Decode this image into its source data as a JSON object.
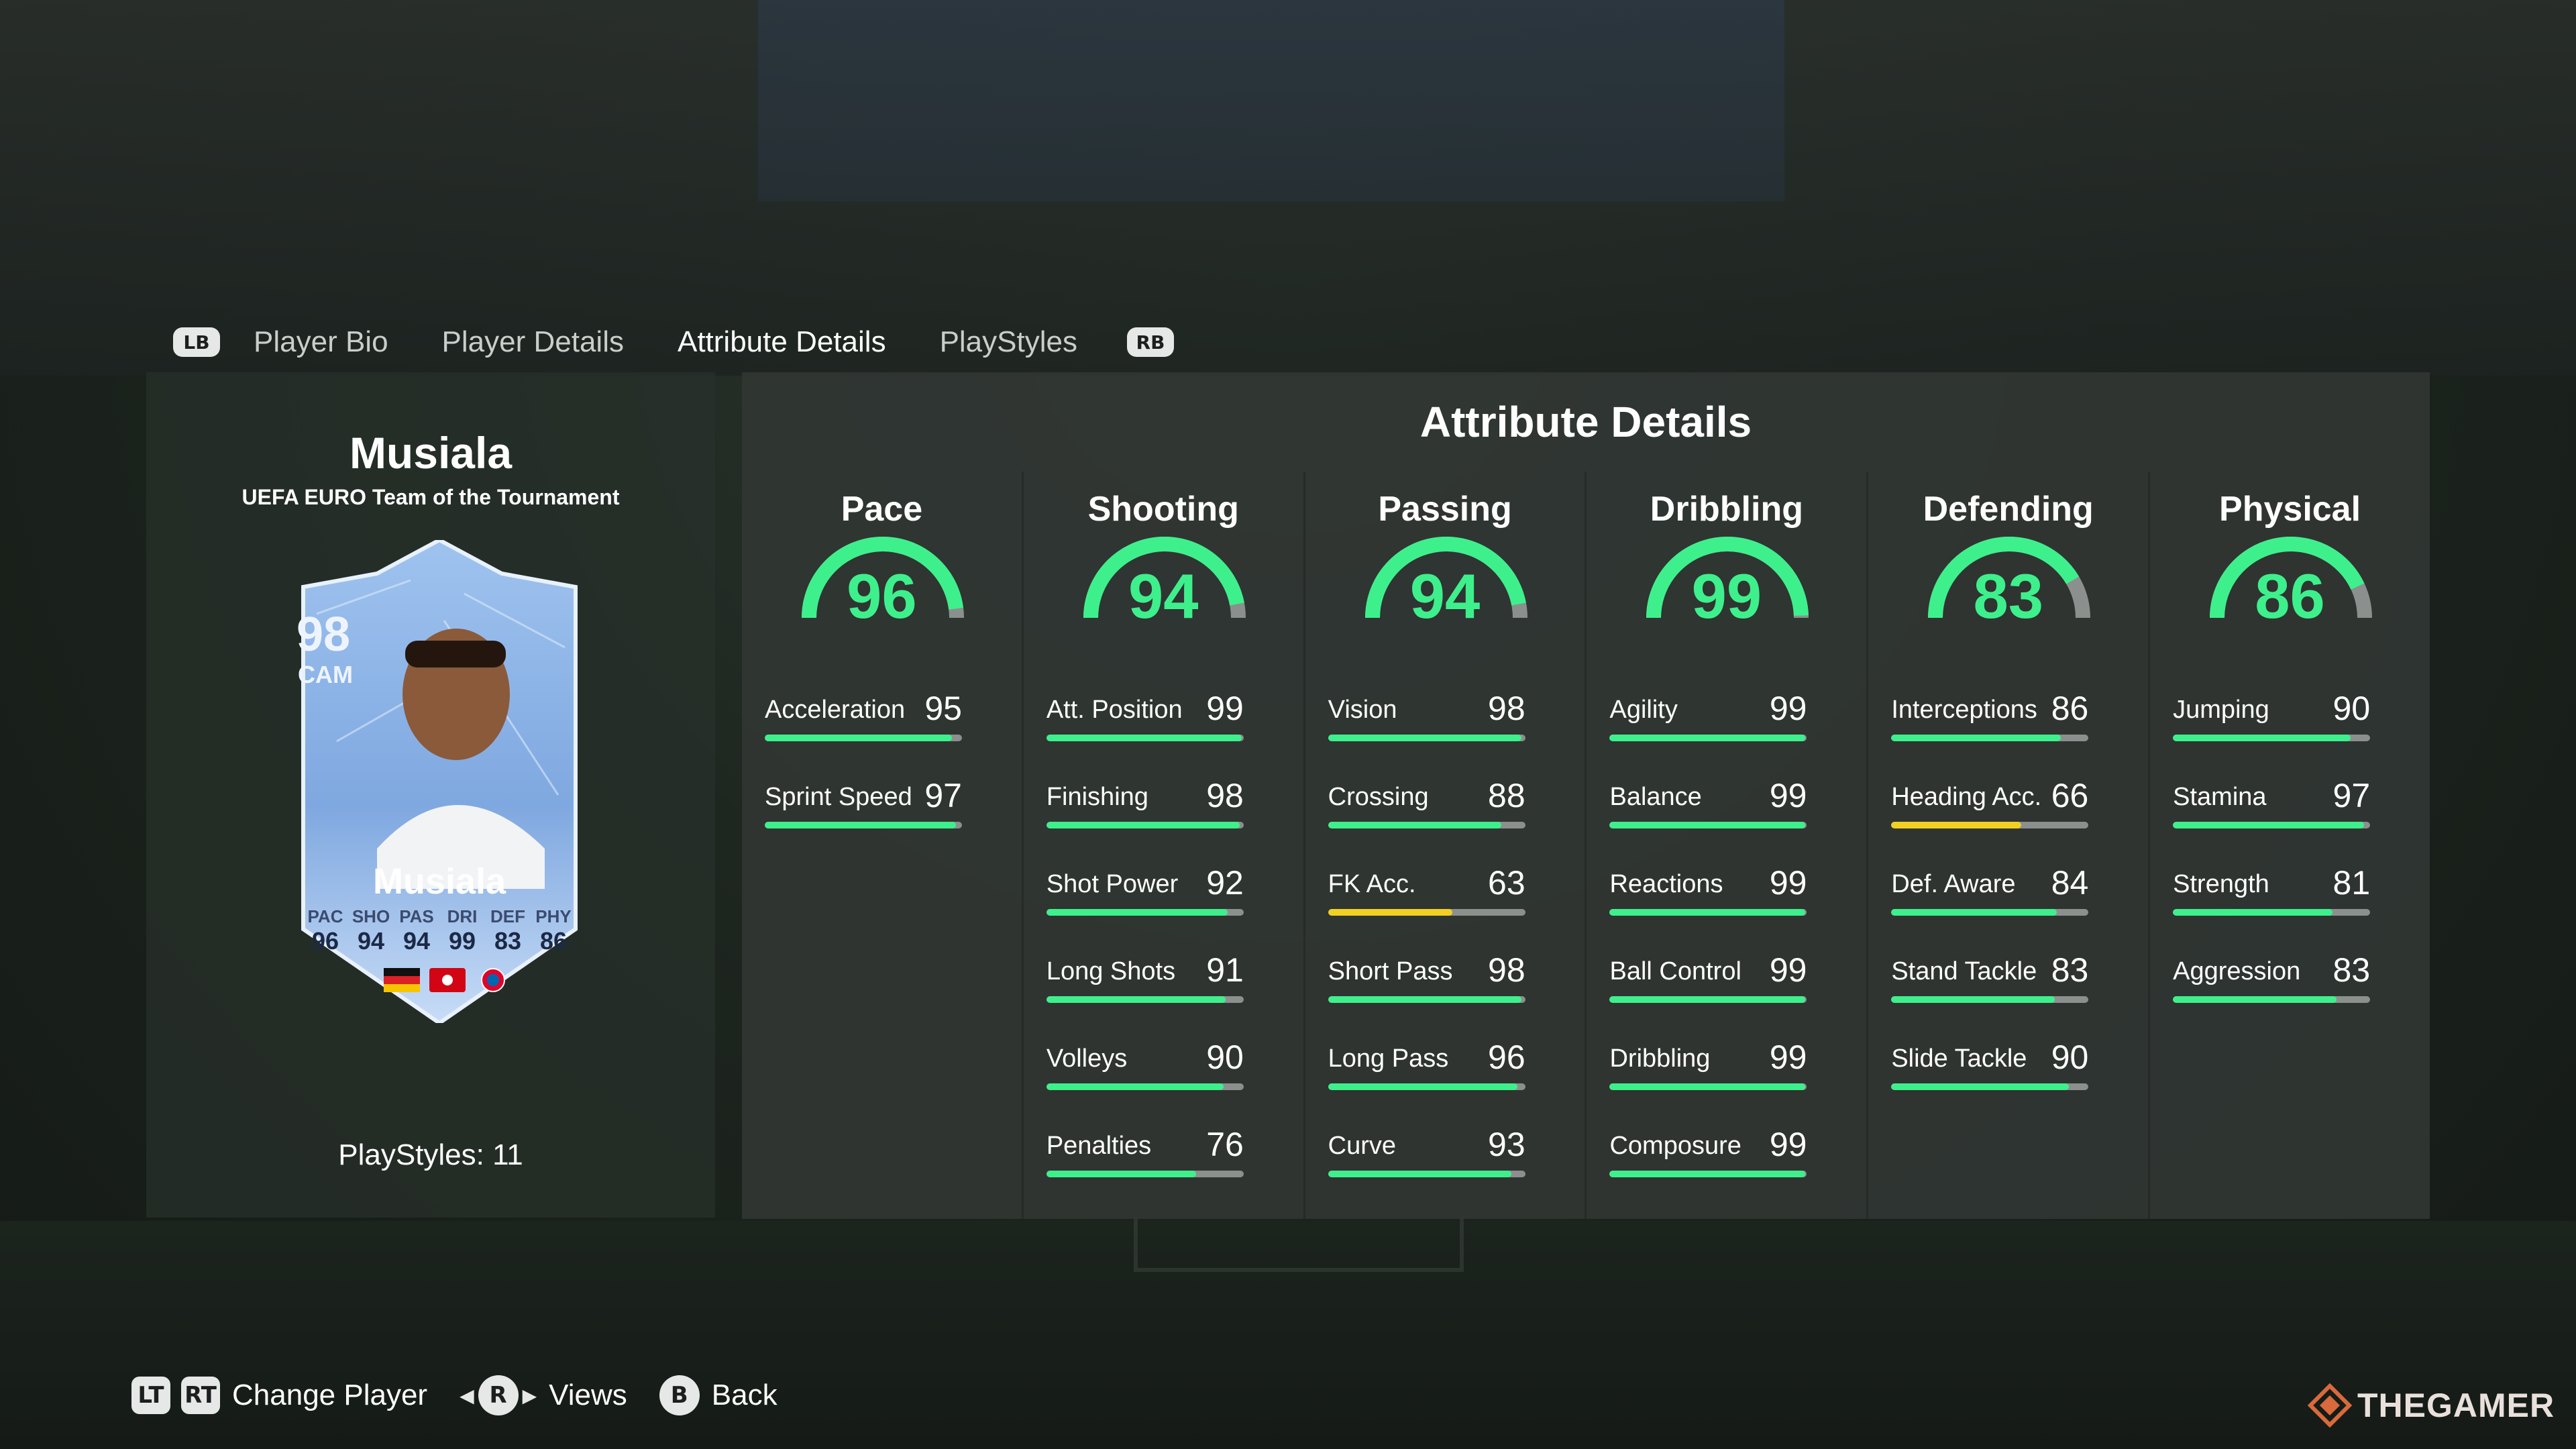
{
  "tabs": {
    "lb": "LB",
    "rb": "RB",
    "items": [
      "Player Bio",
      "Player Details",
      "Attribute Details",
      "PlayStyles"
    ],
    "active": "Attribute Details"
  },
  "player": {
    "name": "Musiala",
    "subtitle": "UEFA EURO Team of the Tournament",
    "card": {
      "rating": "98",
      "position": "CAM",
      "name": "Musiala",
      "stat_labels": [
        "PAC",
        "SHO",
        "PAS",
        "DRI",
        "DEF",
        "PHY"
      ],
      "stat_values": [
        "96",
        "94",
        "94",
        "99",
        "83",
        "86"
      ]
    },
    "playstyles": "PlayStyles: 11"
  },
  "attributes": {
    "title": "Attribute Details",
    "colors": {
      "high": "#3ef08c",
      "mid": "#f2d023",
      "track": "#8b908e"
    },
    "categories": [
      {
        "name": "Pace",
        "value": 96,
        "stats": [
          {
            "label": "Acceleration",
            "value": 95
          },
          {
            "label": "Sprint Speed",
            "value": 97
          }
        ]
      },
      {
        "name": "Shooting",
        "value": 94,
        "stats": [
          {
            "label": "Att. Position",
            "value": 99
          },
          {
            "label": "Finishing",
            "value": 98
          },
          {
            "label": "Shot Power",
            "value": 92
          },
          {
            "label": "Long Shots",
            "value": 91
          },
          {
            "label": "Volleys",
            "value": 90
          },
          {
            "label": "Penalties",
            "value": 76
          }
        ]
      },
      {
        "name": "Passing",
        "value": 94,
        "stats": [
          {
            "label": "Vision",
            "value": 98
          },
          {
            "label": "Crossing",
            "value": 88
          },
          {
            "label": "FK Acc.",
            "value": 63
          },
          {
            "label": "Short Pass",
            "value": 98
          },
          {
            "label": "Long Pass",
            "value": 96
          },
          {
            "label": "Curve",
            "value": 93
          }
        ]
      },
      {
        "name": "Dribbling",
        "value": 99,
        "stats": [
          {
            "label": "Agility",
            "value": 99
          },
          {
            "label": "Balance",
            "value": 99
          },
          {
            "label": "Reactions",
            "value": 99
          },
          {
            "label": "Ball Control",
            "value": 99
          },
          {
            "label": "Dribbling",
            "value": 99
          },
          {
            "label": "Composure",
            "value": 99
          }
        ]
      },
      {
        "name": "Defending",
        "value": 83,
        "stats": [
          {
            "label": "Interceptions",
            "value": 86
          },
          {
            "label": "Heading Acc.",
            "value": 66
          },
          {
            "label": "Def. Aware",
            "value": 84
          },
          {
            "label": "Stand Tackle",
            "value": 83
          },
          {
            "label": "Slide Tackle",
            "value": 90
          }
        ]
      },
      {
        "name": "Physical",
        "value": 86,
        "stats": [
          {
            "label": "Jumping",
            "value": 90
          },
          {
            "label": "Stamina",
            "value": 97
          },
          {
            "label": "Strength",
            "value": 81
          },
          {
            "label": "Aggression",
            "value": 83
          }
        ]
      }
    ]
  },
  "footer": {
    "lt": "LT",
    "rt": "RT",
    "change_player": "Change Player",
    "r": "R",
    "views": "Views",
    "b": "B",
    "back": "Back"
  },
  "watermark": "THEGAMER"
}
